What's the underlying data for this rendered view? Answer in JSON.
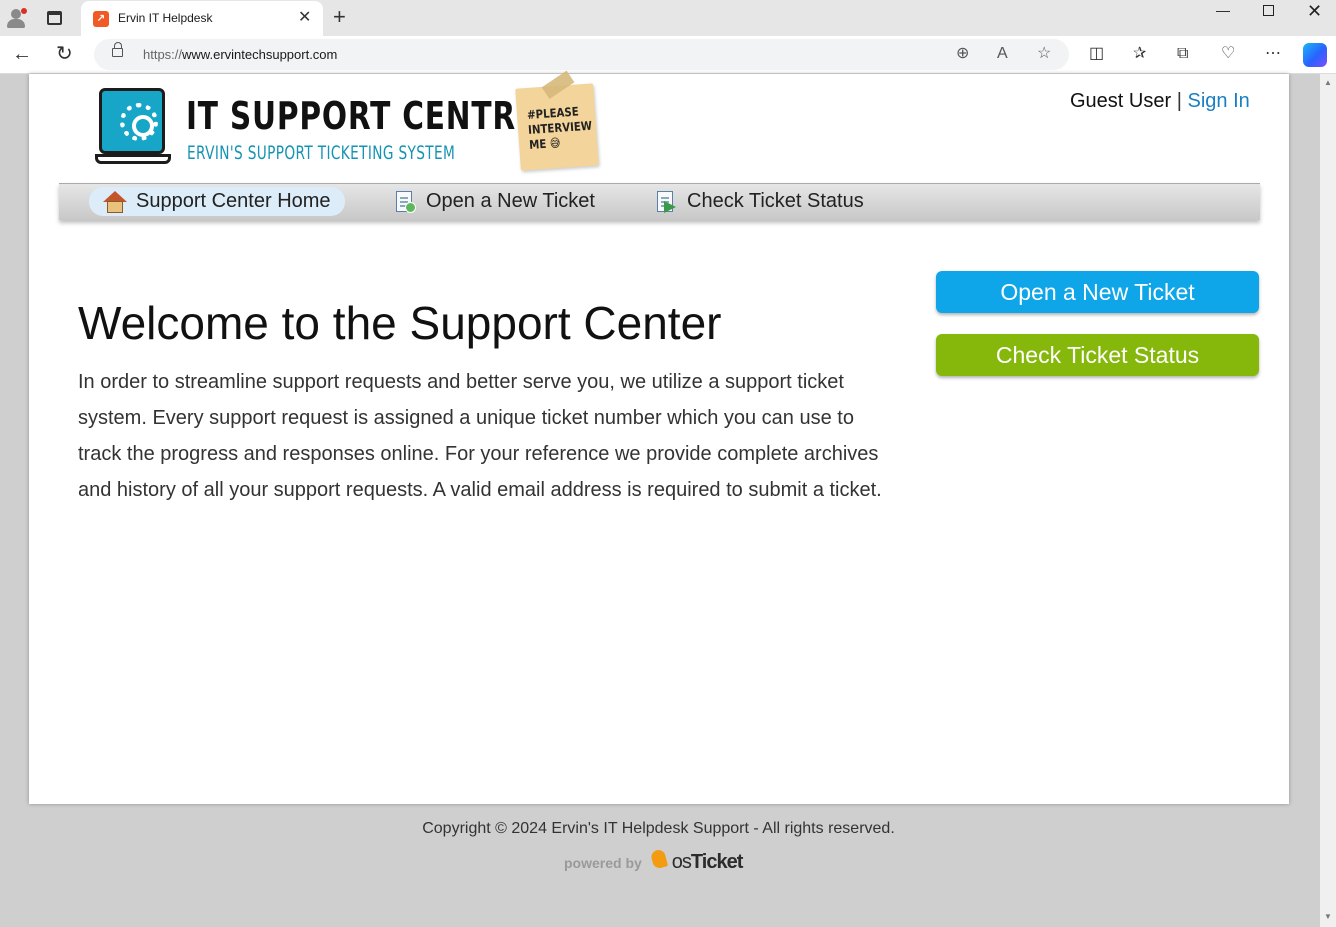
{
  "browser": {
    "tab_title": "Ervin IT Helpdesk",
    "url_scheme": "https://",
    "url_host": "www.ervintechsupport.com",
    "icons": [
      "profile-icon",
      "tab-actions-icon",
      "favicon",
      "close-icon",
      "new-tab-icon",
      "minimize-icon",
      "maximize-icon",
      "close-window-icon",
      "back-icon",
      "reload-icon",
      "lock-icon",
      "zoom-icon",
      "read-aloud-icon",
      "favorite-star-icon",
      "split-screen-icon",
      "favorites-icon",
      "collections-icon",
      "browser-essentials-icon",
      "more-icon",
      "copilot-icon"
    ]
  },
  "header": {
    "logo_title": "IT SUPPORT CENTRE",
    "logo_subtitle": "ERVIN'S SUPPORT TICKETING SYSTEM",
    "sticky_note": "#PLEASE INTERVIEW ME 😅",
    "guest_label": "Guest User",
    "separator": "|",
    "sign_in": "Sign In"
  },
  "nav": {
    "items": [
      {
        "label": "Support Center Home",
        "icon": "house-icon",
        "active": true
      },
      {
        "label": "Open a New Ticket",
        "icon": "new-ticket-icon",
        "active": false
      },
      {
        "label": "Check Ticket Status",
        "icon": "ticket-status-icon",
        "active": false
      }
    ]
  },
  "main": {
    "heading": "Welcome to the Support Center",
    "intro": "In order to streamline support requests and better serve you, we utilize a support ticket system. Every support request is assigned a unique ticket number which you can use to track the progress and responses online. For your reference we provide complete archives and history of all your support requests. A valid email address is required to submit a ticket."
  },
  "sidebar": {
    "open_ticket": "Open a New Ticket",
    "check_status": "Check Ticket Status"
  },
  "footer": {
    "copyright": "Copyright © 2024 Ervin's IT Helpdesk Support - All rights reserved.",
    "powered_by": "powered by",
    "brand_os": "os",
    "brand_ticket": "Ticket"
  },
  "colors": {
    "link": "#1a7fc2",
    "open_button": "#0ea6e8",
    "status_button": "#86b80c",
    "logo_accent": "#1693b4"
  }
}
